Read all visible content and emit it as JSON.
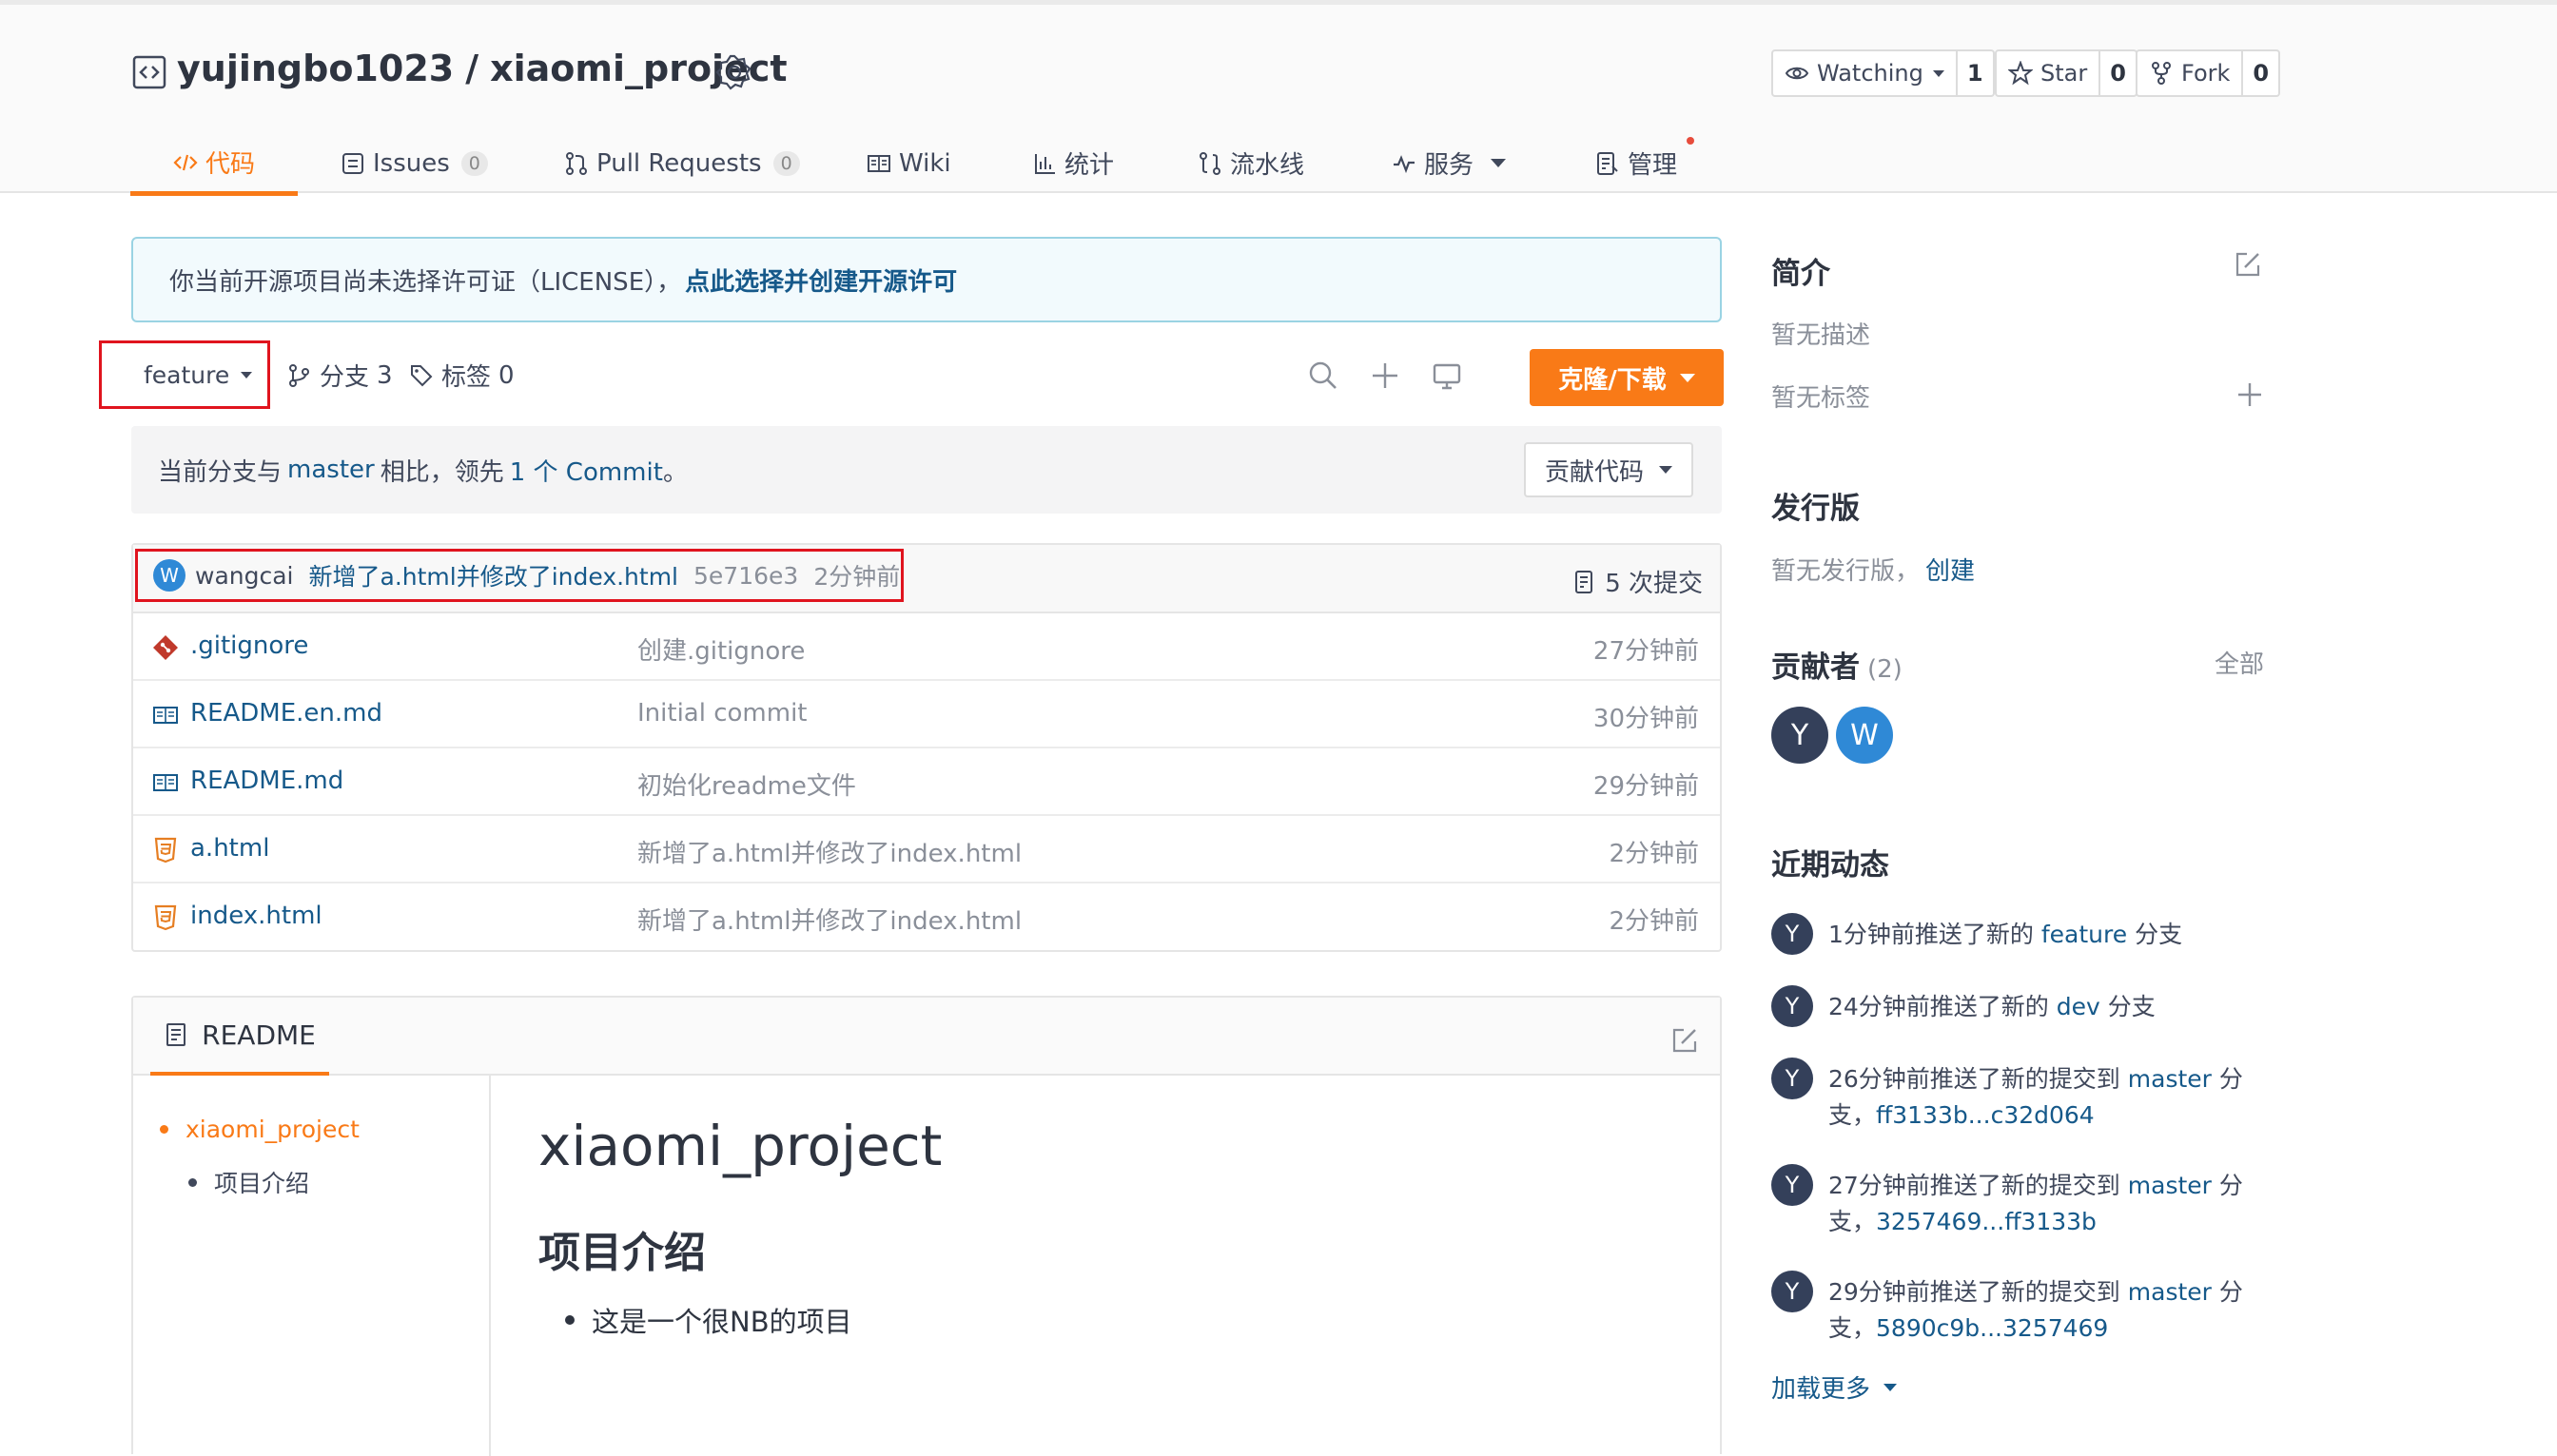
{
  "repo": {
    "owner": "yujingbo1023",
    "separator": "/",
    "name": "xiaomi_project"
  },
  "actions": {
    "watch": {
      "label": "Watching",
      "count": "1"
    },
    "star": {
      "label": "Star",
      "count": "0"
    },
    "fork": {
      "label": "Fork",
      "count": "0"
    }
  },
  "tabs": [
    {
      "label": "代码",
      "icon": "code-icon",
      "active": true
    },
    {
      "label": "Issues",
      "count": "0",
      "icon": "issues-icon"
    },
    {
      "label": "Pull Requests",
      "count": "0",
      "icon": "pull-request-icon"
    },
    {
      "label": "Wiki",
      "icon": "wiki-icon"
    },
    {
      "label": "统计",
      "icon": "stats-icon"
    },
    {
      "label": "流水线",
      "icon": "pipeline-icon"
    },
    {
      "label": "服务",
      "icon": "service-icon"
    },
    {
      "label": "管理",
      "icon": "manage-icon"
    }
  ],
  "license_notice": {
    "text": "你当前开源项目尚未选择许可证（LICENSE），",
    "link": "点此选择并创建开源许可"
  },
  "branch": {
    "current": "feature",
    "branches_label": "分支",
    "branches_count": "3",
    "tags_label": "标签",
    "tags_count": "0",
    "clone_label": "克隆/下载"
  },
  "compare": {
    "prefix": "当前分支与",
    "base": "master",
    "middle": "相比，领先",
    "ahead": "1 个 Commit",
    "suffix": "。",
    "contribute_label": "贡献代码"
  },
  "last_commit": {
    "avatar": "W",
    "author": "wangcai",
    "message": "新增了a.html并修改了index.html",
    "sha": "5e716e3",
    "time": "2分钟前",
    "total_label": "5 次提交"
  },
  "files": [
    {
      "name": ".gitignore",
      "icon": "git-icon",
      "message": "创建.gitignore",
      "time": "27分钟前"
    },
    {
      "name": "README.en.md",
      "icon": "book-icon",
      "message": "Initial commit",
      "time": "30分钟前"
    },
    {
      "name": "README.md",
      "icon": "book-icon",
      "message": "初始化readme文件",
      "time": "29分钟前"
    },
    {
      "name": "a.html",
      "icon": "html5-icon",
      "message": "新增了a.html并修改了index.html",
      "time": "2分钟前"
    },
    {
      "name": "index.html",
      "icon": "html5-icon",
      "message": "新增了a.html并修改了index.html",
      "time": "2分钟前"
    }
  ],
  "readme": {
    "tab_label": "README",
    "toc": [
      "xiaomi_project",
      "项目介绍"
    ],
    "h1": "xiaomi_project",
    "h2": "项目介绍",
    "bullet": "这是一个很NB的项目"
  },
  "sidebar": {
    "intro_title": "简介",
    "no_description": "暂无描述",
    "no_tags": "暂无标签",
    "releases_title": "发行版",
    "no_releases": "暂无发行版，",
    "create_link": "创建",
    "contributors_title": "贡献者",
    "contributors_count": "(2)",
    "all_link": "全部",
    "contributors": [
      {
        "initial": "Y",
        "color": "#34405a"
      },
      {
        "initial": "W",
        "color": "#2f89d6"
      }
    ],
    "activity_title": "近期动态",
    "activity": [
      {
        "avatar": "Y",
        "pre": "1分钟前推送了新的",
        "branch": "feature",
        "post": "分支",
        "range": ""
      },
      {
        "avatar": "Y",
        "pre": "24分钟前推送了新的",
        "branch": "dev",
        "post": "分支",
        "range": ""
      },
      {
        "avatar": "Y",
        "pre": "26分钟前推送了新的提交到",
        "branch": "master",
        "post": "分支，",
        "range": "ff3133b...c32d064"
      },
      {
        "avatar": "Y",
        "pre": "27分钟前推送了新的提交到",
        "branch": "master",
        "post": "分支，",
        "range": "3257469...ff3133b"
      },
      {
        "avatar": "Y",
        "pre": "29分钟前推送了新的提交到",
        "branch": "master",
        "post": "分支，",
        "range": "5890c9b...3257469"
      }
    ],
    "load_more": "加载更多"
  },
  "colors": {
    "accent": "#f97a17",
    "link": "#16598a",
    "highlight_box": "#e0141e"
  }
}
